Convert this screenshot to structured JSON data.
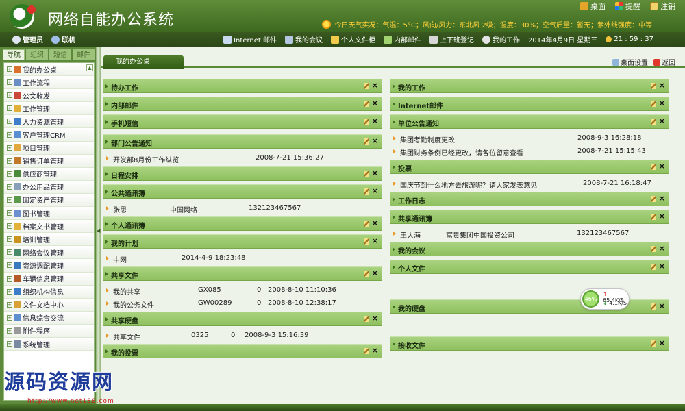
{
  "header": {
    "title": "网络自能办公系统",
    "links": [
      {
        "label": "桌面",
        "icon": "desktop-icon"
      },
      {
        "label": "提醒",
        "icon": "reminder-icon"
      },
      {
        "label": "注销",
        "icon": "logout-icon"
      }
    ],
    "weather": "今日天气实况：气温：5°C；风向/风力：东北风 2级；湿度：30%；空气质量：暂无；紫外线强度：中等"
  },
  "infobar": {
    "user": "管理员",
    "status": "联机",
    "quick": [
      "Internet 邮件",
      "我的会议",
      "个人文件柜",
      "内部邮件",
      "上下班登记",
      "我的工作"
    ],
    "date": "2014年4月9日 星期三",
    "time": "21 : 59 : 37"
  },
  "nav": {
    "tabs": [
      "导航",
      "组织",
      "短信",
      "邮件"
    ],
    "items": [
      "我的办公桌",
      "工作流程",
      "公文收发",
      "工作管理",
      "人力资源管理",
      "客户管理CRM",
      "项目管理",
      "销售订单管理",
      "供应商管理",
      "办公用品管理",
      "固定资产管理",
      "图书管理",
      "档案文书管理",
      "培训管理",
      "网络会议管理",
      "资源调配管理",
      "车辆信息管理",
      "组织机构信息",
      "文件文档中心",
      "信息综合交流",
      "附件程序",
      "系统管理"
    ]
  },
  "main": {
    "tab": "我的办公桌",
    "desk_settings": "桌面设置",
    "back": "返回"
  },
  "panels_left": [
    {
      "title": "待办工作",
      "rows": []
    },
    {
      "title": "内部邮件",
      "rows": []
    },
    {
      "title": "手机短信",
      "rows": [],
      "gap": 3
    },
    {
      "title": "部门公告通知",
      "rows": [
        [
          "开发部8月份工作纵览",
          "2008-7-21 15:36:27"
        ]
      ]
    },
    {
      "title": "日程安排",
      "rows": []
    },
    {
      "title": "公共通讯簿",
      "rows": [
        [
          "张思",
          "中国网络",
          "132123467567"
        ]
      ]
    },
    {
      "title": "个人通讯簿",
      "rows": []
    },
    {
      "title": "我的计划",
      "rows": [
        [
          "中网",
          "2014-4-9 18:23:48"
        ]
      ]
    },
    {
      "title": "共享文件",
      "rows": [
        [
          "我的共享",
          "GX085",
          "0",
          "2008-8-10 11:10:36"
        ],
        [
          "我的公务文件",
          "GW00289",
          "0",
          "2008-8-10 12:38:17"
        ]
      ]
    },
    {
      "title": "共享硬盘",
      "rows": [
        [
          "共享文件",
          "0325",
          "0",
          "2008-9-3 15:16:39"
        ]
      ]
    },
    {
      "title": "我的投票",
      "rows": []
    }
  ],
  "panels_right": [
    {
      "title": "我的工作",
      "rows": []
    },
    {
      "title": "Internet邮件",
      "rows": []
    },
    {
      "title": "单位公告通知",
      "rows": [
        [
          "集团考勤制度更改",
          "2008-9-3 16:28:18"
        ],
        [
          "集团财务条例已经更改，请各位留意查看",
          "2008-7-21 15:15:43"
        ]
      ]
    },
    {
      "title": "投票",
      "rows": [
        [
          "国庆节到什么地方去旅游呢？请大家发表意见",
          "2008-7-21 16:18:47"
        ]
      ]
    },
    {
      "title": "工作日志",
      "rows": []
    },
    {
      "title": "共享通讯簿",
      "rows": [
        [
          "王大海",
          "富贵集团中国投资公司",
          "132123467567"
        ]
      ]
    },
    {
      "title": "我的会议",
      "rows": []
    },
    {
      "title": "个人文件",
      "rows": [],
      "gap": 32
    },
    {
      "title": "我的硬盘",
      "rows": [],
      "gap": 28
    },
    {
      "title": "接收文件",
      "rows": []
    }
  ],
  "speed": {
    "percent": "46%",
    "up": "65.4K/S",
    "down": "4.1K/S"
  },
  "watermark": {
    "text": "源码资源网",
    "url": "http://www.net188.com"
  }
}
